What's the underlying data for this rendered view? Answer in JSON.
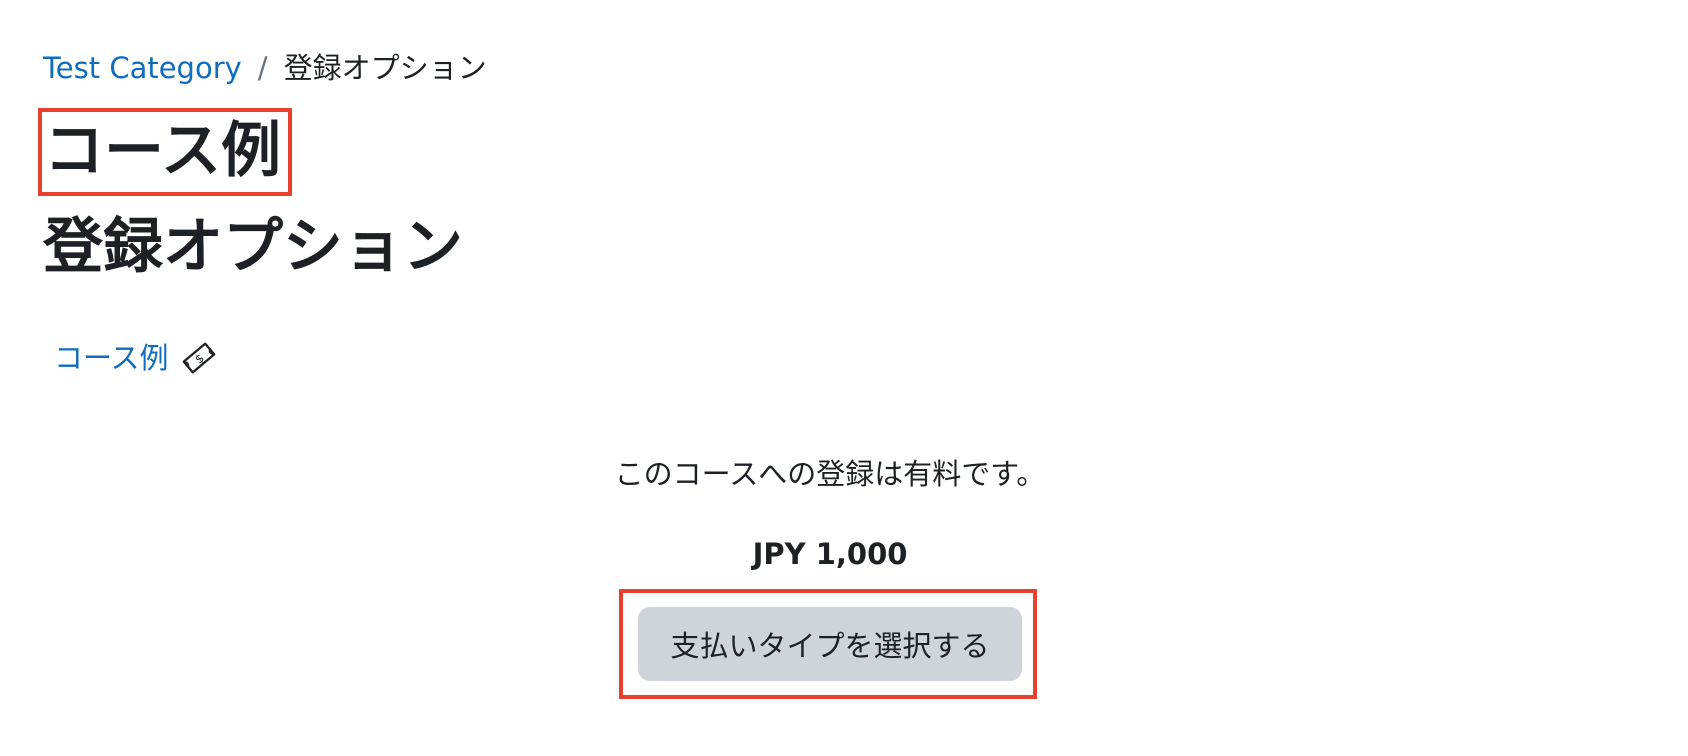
{
  "breadcrumb": {
    "category_link": "Test Category",
    "separator": "/",
    "current": "登録オプション"
  },
  "course_title": "コース例",
  "page_heading": "登録オプション",
  "course_link": {
    "label": "コース例",
    "icon": "payment-bill-icon"
  },
  "enrolment": {
    "fee_message": "このコースへの登録は有料です。",
    "cost": "JPY 1,000",
    "button_label": "支払いタイプを選択する"
  },
  "colors": {
    "link": "#0f6cbf",
    "text": "#1d2125",
    "button_bg": "#ced4da",
    "highlight": "#e8402f"
  }
}
